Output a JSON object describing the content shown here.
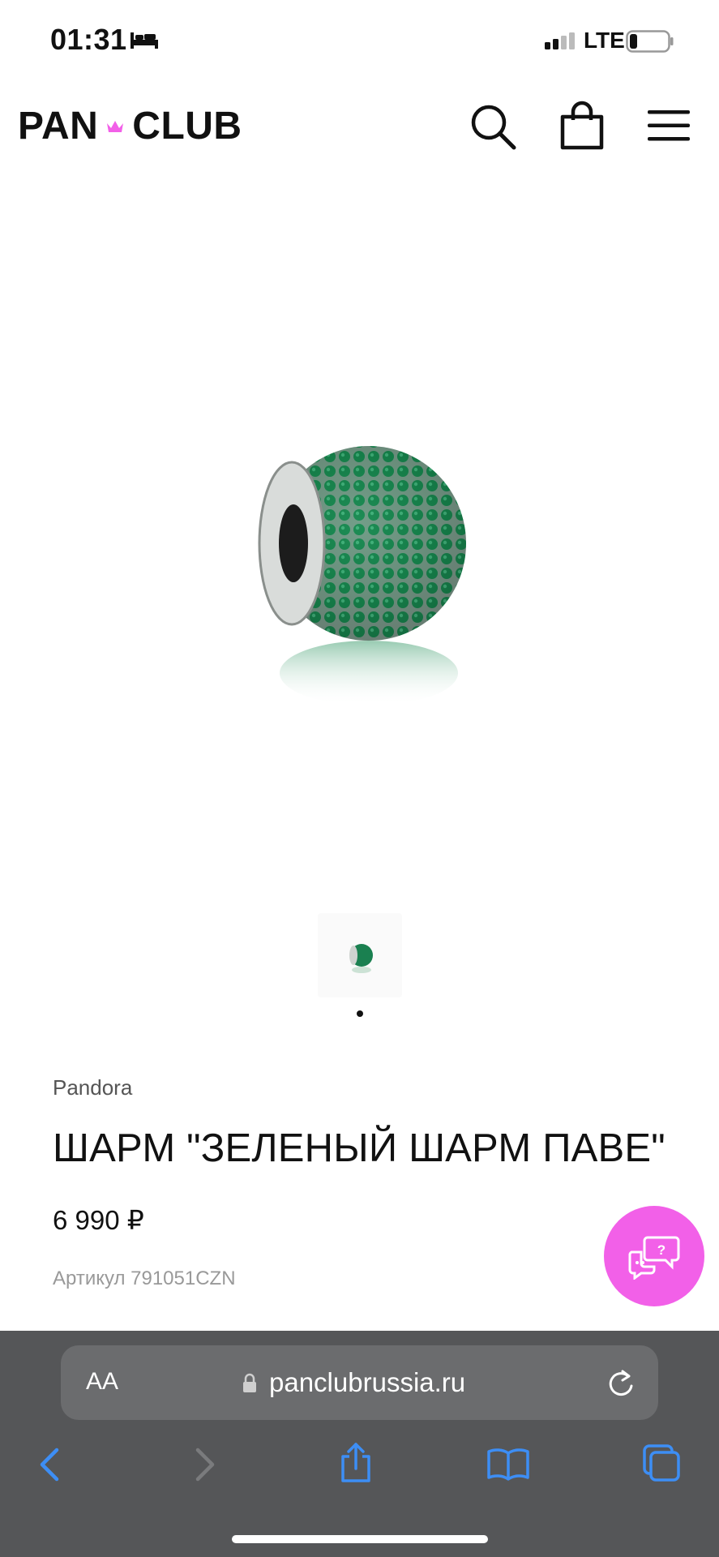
{
  "status_bar": {
    "time": "01:31",
    "network": "LTE",
    "icons": [
      "bed-icon",
      "signal-icon",
      "battery-icon"
    ]
  },
  "header": {
    "logo_left": "PAN",
    "logo_right": "CLUB",
    "logo_accent_color": "#f260e8",
    "icons": [
      "search-icon",
      "bag-icon",
      "menu-icon"
    ]
  },
  "product": {
    "brand": "Pandora",
    "title": "ШАРМ \"ЗЕЛЕНЫЙ ШАРМ ПАВЕ\"",
    "price": "6 990 ₽",
    "sku": "Артикул 791051CZN",
    "gallery": {
      "image_count": 1,
      "current_index": 1
    }
  },
  "chat": {
    "icon": "chat-help-icon",
    "color": "#f260e8"
  },
  "browser": {
    "aa_label": "AA",
    "url": "panclubrussia.ru",
    "icons": [
      "lock-icon",
      "reload-icon",
      "back-icon",
      "forward-icon",
      "share-icon",
      "bookmarks-icon",
      "tabs-icon"
    ],
    "accent_color": "#3d8ef5"
  }
}
